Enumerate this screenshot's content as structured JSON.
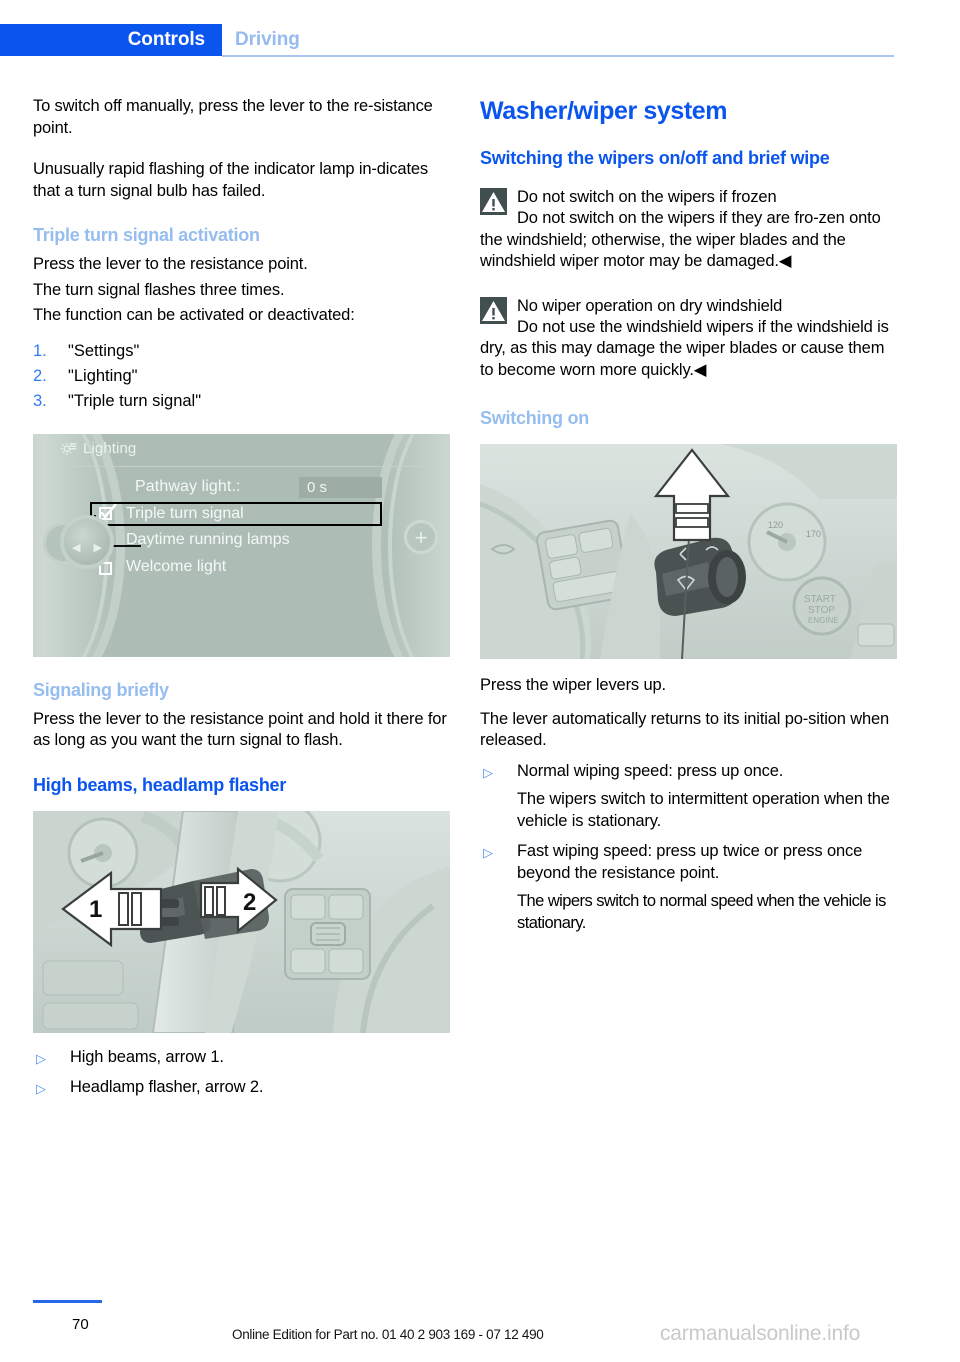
{
  "header": {
    "active_tab": "Controls",
    "inactive_tab": "Driving",
    "active_color": "#0b55ef",
    "inactive_color": "#95bbf2"
  },
  "left_column": {
    "para1": "To switch off manually, press the lever to the re-sistance point.",
    "para2": "Unusually rapid flashing of the indicator lamp in-dicates that a turn signal bulb has failed.",
    "heading1": "Triple turn signal activation",
    "para3": "Press the lever to the resistance point.",
    "para4": "The turn signal flashes three times.",
    "para5": "The function can be activated or deactivated:",
    "steps": [
      {
        "num": "1.",
        "label": "\"Settings\""
      },
      {
        "num": "2.",
        "label": "\"Lighting\""
      },
      {
        "num": "3.",
        "label": "\"Triple turn signal\""
      }
    ],
    "idrive": {
      "title": "Lighting",
      "icon": "gear-icon",
      "pathway_label": "Pathway light.:",
      "pathway_value": "0 s",
      "items": [
        {
          "label": "Triple turn signal",
          "checked": true,
          "selected": true
        },
        {
          "label": "Daytime running lamps",
          "checked": false,
          "selected": false
        },
        {
          "label": "Welcome light",
          "checked": false,
          "selected": false
        }
      ],
      "plus_label": "+"
    },
    "heading2": "Signaling briefly",
    "para6": "Press the lever to the resistance point and hold it there for as long as you want the turn signal to flash.",
    "heading3": "High beams, headlamp flasher",
    "bullets": [
      "High beams, arrow 1.",
      "Headlamp flasher, arrow 2."
    ],
    "photo_labels": {
      "arrow1": "1",
      "arrow2": "2"
    }
  },
  "right_column": {
    "heading_main": "Washer/wiper system",
    "heading_sub1": "Switching the wipers on/off and brief wipe",
    "warnings": [
      {
        "icon": "warning-triangle-icon",
        "title": "Do not switch on the wipers if frozen",
        "body": "Do not switch on the wipers if they are fro-zen onto the windshield; otherwise, the wiper blades and the windshield wiper motor may be damaged.◀"
      },
      {
        "icon": "warning-triangle-icon",
        "title": "No wiper operation on dry windshield",
        "body": "Do not use the windshield wipers if the windshield is dry, as this may damage the wiper blades or cause them to become worn more quickly.◀"
      }
    ],
    "heading_sub2": "Switching on",
    "para1": "Press the wiper levers up.",
    "para2": "The lever automatically returns to its initial po-sition when released.",
    "bullets": [
      {
        "text": "Normal wiping speed: press up once.",
        "sub": "The wipers switch to intermittent operation when the vehicle is stationary."
      },
      {
        "text": "Fast wiping speed: press up twice or press once beyond the resistance point.",
        "sub": "The wipers switch to normal speed when the vehicle is stationary."
      }
    ],
    "photo_labels": {
      "start_stop": "START STOP",
      "gauge": "120"
    }
  },
  "footer": {
    "page_number": "70",
    "edition_text": "Online Edition for Part no. 01 40 2 903 169 - 07 12 490",
    "watermark": "carmanualsonline.info",
    "rule_color": "#2467e8"
  }
}
